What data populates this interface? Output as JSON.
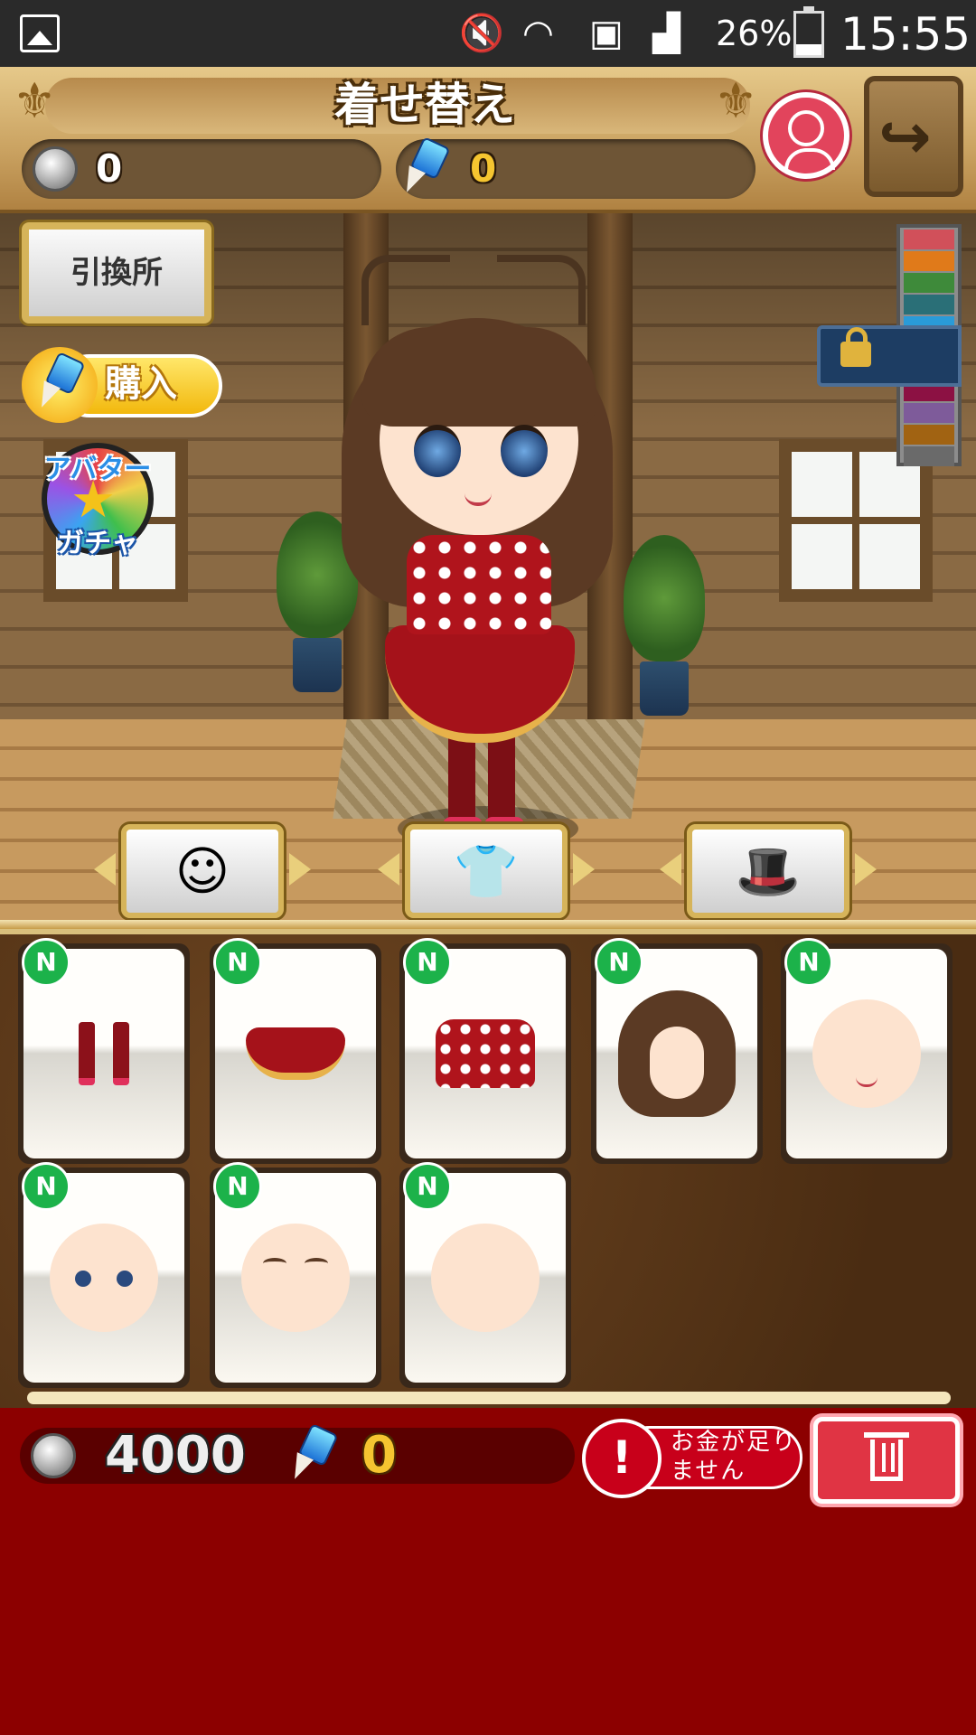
{
  "status_bar": {
    "battery_percent": "26%",
    "time": "15:55",
    "icons": [
      "gallery-icon",
      "mute-icon",
      "wifi-icon",
      "sim-error-icon",
      "signal-icon",
      "battery-icon"
    ]
  },
  "header": {
    "title": "着せ替え",
    "coins": "0",
    "gems": "0"
  },
  "room": {
    "exchange_label": "引換所",
    "purchase_label": "購入",
    "gacha_line1": "アバター",
    "gacha_line2": "ガチャ",
    "palette_colors": [
      "#d1505a",
      "#e07a1a",
      "#3e8a3a",
      "#2a6f77",
      "#2a9bd8",
      "#1d3d63",
      "#1d3d63",
      "#8c1143",
      "#7e5b9a",
      "#a16312",
      "#6a6a6a"
    ]
  },
  "categories": [
    {
      "name": "face",
      "icon": "face-icon",
      "glyph": "☺",
      "selected": false
    },
    {
      "name": "clothes",
      "icon": "clothes-icon",
      "glyph": "👕",
      "selected": true
    },
    {
      "name": "accessories",
      "icon": "hat-glasses-icon",
      "glyph": "🎩",
      "selected": false
    }
  ],
  "items": [
    {
      "rarity": "N",
      "kind": "legs"
    },
    {
      "rarity": "N",
      "kind": "skirt"
    },
    {
      "rarity": "N",
      "kind": "top"
    },
    {
      "rarity": "N",
      "kind": "hair"
    },
    {
      "rarity": "N",
      "kind": "mouth"
    },
    {
      "rarity": "N",
      "kind": "eyes"
    },
    {
      "rarity": "N",
      "kind": "eyebrows"
    },
    {
      "rarity": "N",
      "kind": "face-base"
    }
  ],
  "bottom": {
    "coins": "4000",
    "gems": "0",
    "warning_text": "お金が足りません"
  }
}
